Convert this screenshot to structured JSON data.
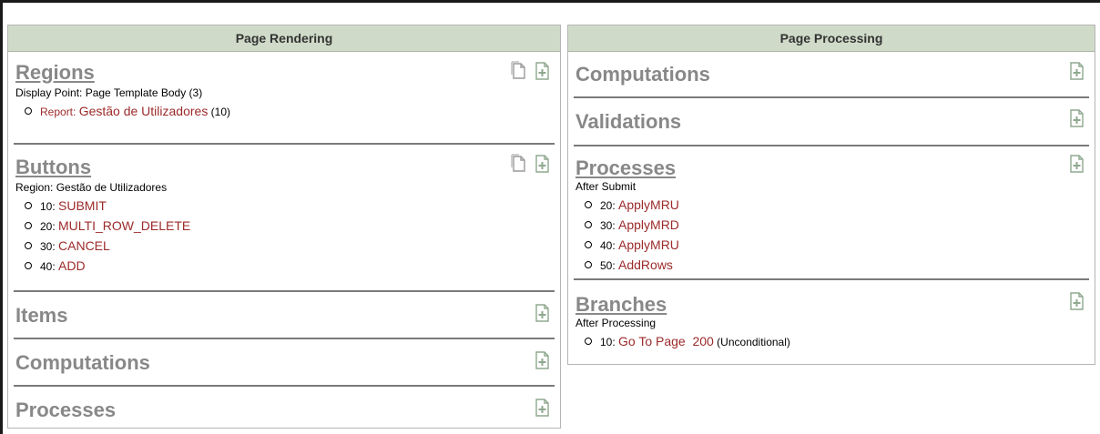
{
  "rendering": {
    "header": "Page Rendering",
    "regions": {
      "title": "Regions",
      "subtitle": "Display Point: Page Template Body (3)",
      "items": [
        {
          "prefix": "Report: ",
          "label": "Gestão de Utilizadores",
          "suffix": " (10)"
        }
      ]
    },
    "buttons": {
      "title": "Buttons",
      "subtitle": "Region: Gestão de Utilizadores",
      "items": [
        {
          "num": "10: ",
          "label": "SUBMIT"
        },
        {
          "num": "20: ",
          "label": "MULTI_ROW_DELETE"
        },
        {
          "num": "30: ",
          "label": "CANCEL"
        },
        {
          "num": "40: ",
          "label": "ADD"
        }
      ]
    },
    "items_title": "Items",
    "computations_title": "Computations",
    "processes_title": "Processes"
  },
  "processing": {
    "header": "Page Processing",
    "computations_title": "Computations",
    "validations_title": "Validations",
    "processes": {
      "title": "Processes",
      "subtitle": "After Submit",
      "items": [
        {
          "num": "20: ",
          "label": "ApplyMRU"
        },
        {
          "num": "30: ",
          "label": "ApplyMRD"
        },
        {
          "num": "40: ",
          "label": "ApplyMRU"
        },
        {
          "num": "50: ",
          "label": "AddRows"
        }
      ]
    },
    "branches": {
      "title": "Branches",
      "subtitle": "After Processing",
      "items": [
        {
          "num": "10: ",
          "label": "Go To Page  200",
          "suffix": " (Unconditional)"
        }
      ]
    }
  },
  "icons": {
    "copy": "copy-icon",
    "create": "create-icon"
  }
}
